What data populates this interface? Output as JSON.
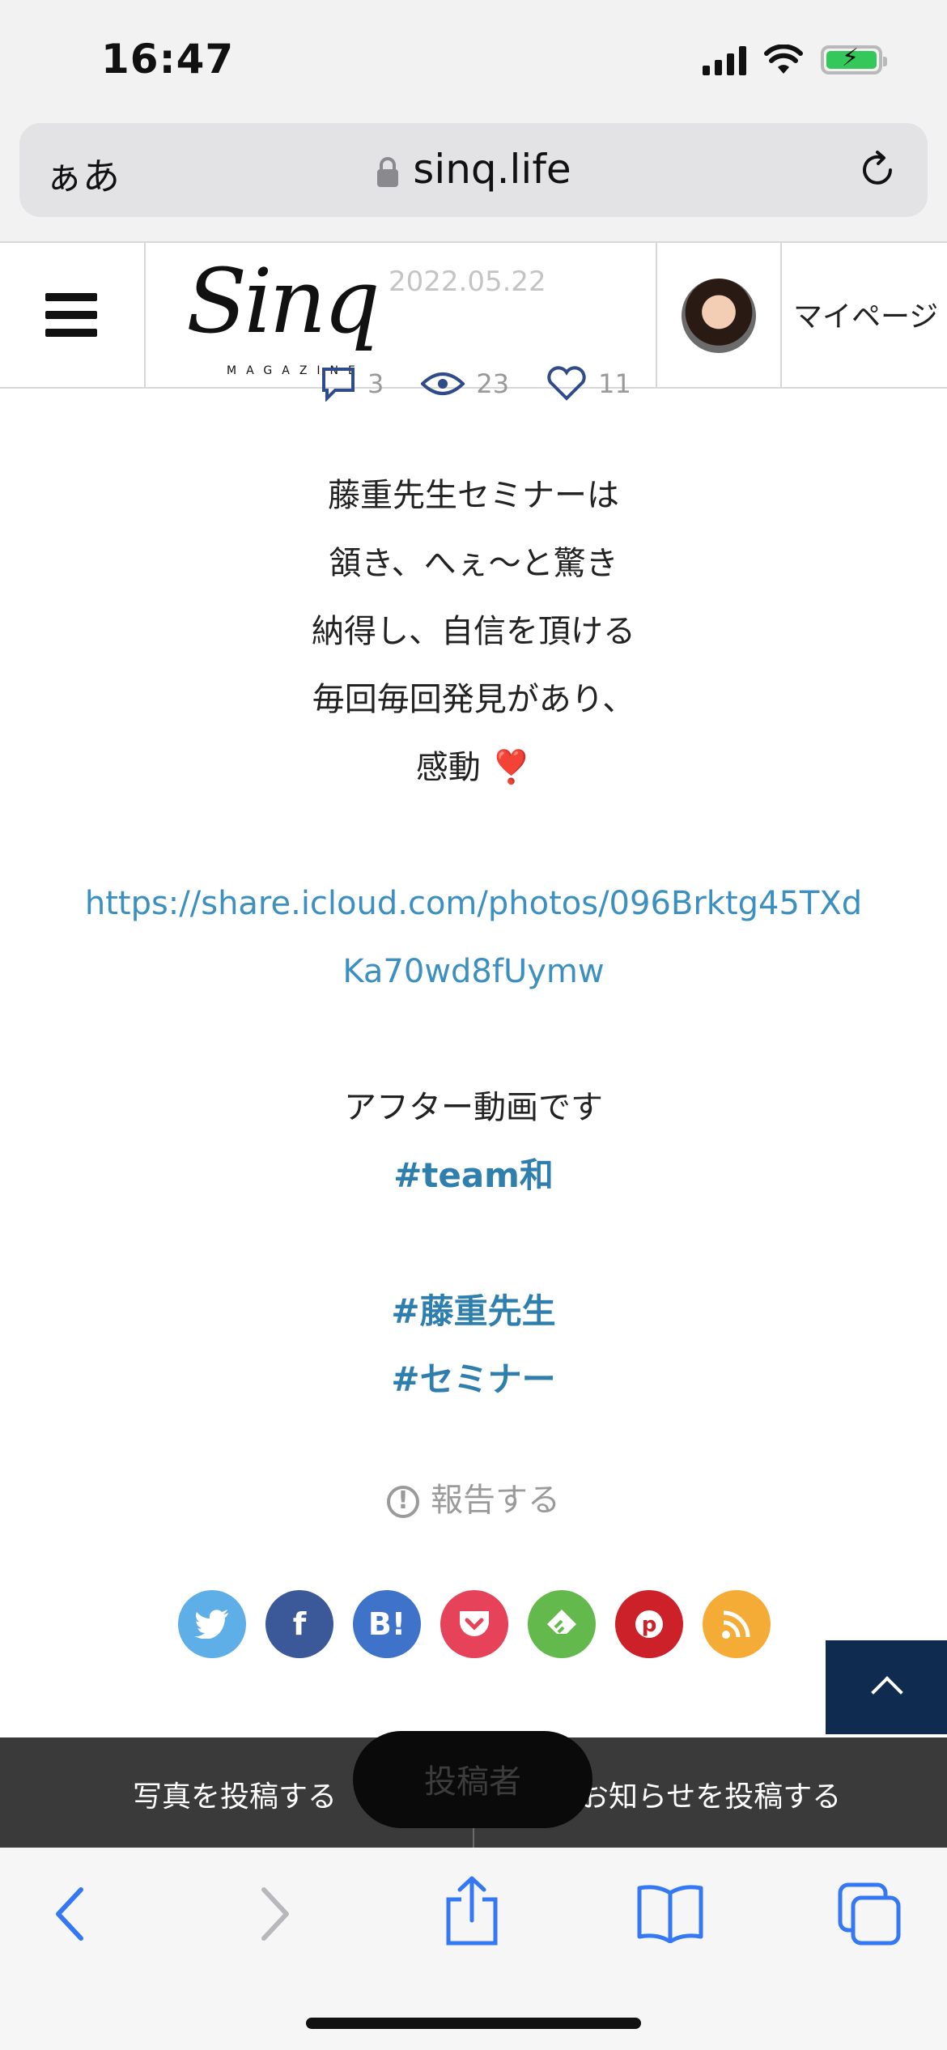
{
  "status_bar": {
    "time": "16:47"
  },
  "url_bar": {
    "aa_label": "ぁあ",
    "domain": "sinq.life"
  },
  "site_header": {
    "logo_text": "Sinq",
    "logo_subtitle": "MAGAZINE",
    "date": "2022.05.22",
    "mypage_label": "マイページ"
  },
  "stats": {
    "comments": "3",
    "views": "23",
    "likes": "11"
  },
  "content": {
    "lines": [
      "藤重先生セミナーは",
      "頷き、へぇ〜と驚き",
      "納得し、自信を頂ける",
      "毎回毎回発見があり、",
      "感動 ❣️"
    ],
    "link_line1": "https://share.icloud.com/photos/096Brktg45TXd",
    "link_line2": "Ka70wd8fUymw",
    "after_video": "アフター動画です",
    "tags": [
      "#team和",
      "#藤重先生",
      "#セミナー"
    ]
  },
  "report_label": "報告する",
  "share_buttons": [
    {
      "name": "twitter",
      "label": "🐦",
      "color": "#5eaee8"
    },
    {
      "name": "facebook",
      "label": "f",
      "color": "#3b5998"
    },
    {
      "name": "hatena",
      "label": "B!",
      "color": "#3e73c9"
    },
    {
      "name": "pocket",
      "label": "⌵",
      "color": "#e6425a"
    },
    {
      "name": "feedly",
      "label": "f",
      "color": "#63b94c"
    },
    {
      "name": "pinterest",
      "label": "P",
      "color": "#cc2129"
    },
    {
      "name": "rss",
      "label": "))",
      "color": "#f5ac36"
    }
  ],
  "post_bar": {
    "photo_label": "写真を投稿する",
    "poster_label": "投稿者",
    "notice_label": "お知らせを投稿する"
  },
  "colors": {
    "link": "#3b8fc1",
    "tag": "#2f7fae",
    "accent_nav": "#0f2b4f",
    "safari_blue": "#3478f6"
  }
}
